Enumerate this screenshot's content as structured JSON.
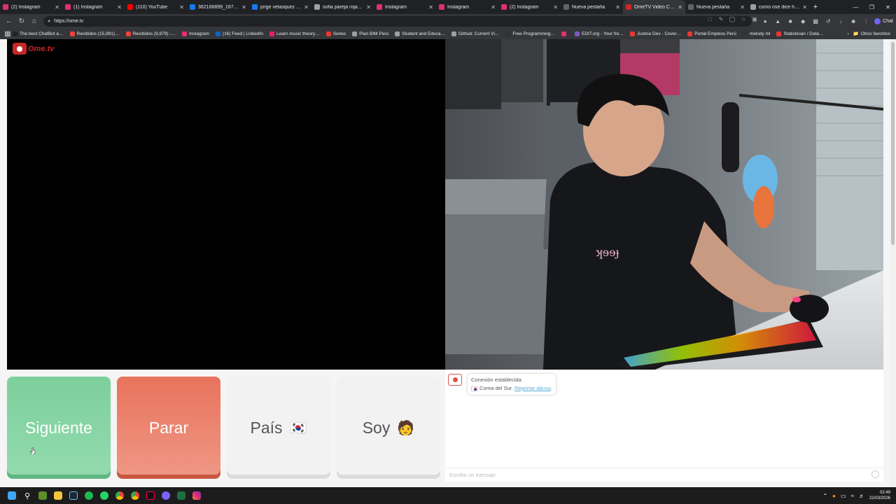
{
  "browser": {
    "tabs": [
      {
        "title": "(2) Instagram",
        "color": "#e1306c"
      },
      {
        "title": "(1) Instagram",
        "color": "#e1306c"
      },
      {
        "title": "(110) YouTube",
        "color": "#ff0000"
      },
      {
        "title": "362166899_16787548…",
        "color": "#1877f2"
      },
      {
        "title": "jorge velasquez mata…",
        "color": "#1877f2"
      },
      {
        "title": "sofia pareja rojas san…",
        "color": "#9aa0a6"
      },
      {
        "title": "Instagram",
        "color": "#e1306c"
      },
      {
        "title": "Instagram",
        "color": "#e1306c"
      },
      {
        "title": "(2) Instagram",
        "color": "#e1306c"
      },
      {
        "title": "Nueva pestaña",
        "color": "#5f6368"
      },
      {
        "title": "OmeTV Video Chat",
        "color": "#c62828",
        "active": true
      },
      {
        "title": "Nueva pestaña",
        "color": "#5f6368"
      },
      {
        "title": "como ose dice hola en…",
        "color": "#9aa0a6"
      }
    ],
    "url": "https://ome.tv",
    "chat_button": "Chat",
    "bookmarks": [
      {
        "label": "The best ChatBot a…",
        "color": "#222"
      },
      {
        "label": "Recibidos (15,891)…",
        "color": "#ea4335"
      },
      {
        "label": "Recibidos (9,879) -…",
        "color": "#ea4335"
      },
      {
        "label": "Instagram",
        "color": "#e1306c"
      },
      {
        "label": "(16) Feed | LinkedIn",
        "color": "#0a66c2"
      },
      {
        "label": "Learn music theory…",
        "color": "#e91e63"
      },
      {
        "label": "Series",
        "color": "#e53935"
      },
      {
        "label": "Plan BIM Perú",
        "color": "#9e9e9e"
      },
      {
        "label": "Student and Educa…",
        "color": "#9e9e9e"
      },
      {
        "label": "Github: Current Vi…",
        "color": "#9e9e9e"
      },
      {
        "label": "Free Programming…",
        "color": "#333"
      },
      {
        "label": "",
        "color": "#e1306c"
      },
      {
        "label": "EDIT.org - Your fre…",
        "color": "#7e57c2"
      },
      {
        "label": "Justice Dev - Cover…",
        "color": "#e53935"
      },
      {
        "label": "Portal Empleos Perú",
        "color": "#e53935"
      },
      {
        "label": "melody ml",
        "color": "#333"
      },
      {
        "label": "Statistician / Data…",
        "color": "#e53935"
      }
    ],
    "other_bookmarks": "Otros favoritos"
  },
  "app": {
    "logo_text": "Ome.tv",
    "buttons": {
      "next": "Siguiente",
      "stop": "Parar",
      "country": "País",
      "country_flag": "🇰🇷",
      "gender": "Soy",
      "gender_emoji": "🧑"
    },
    "chat": {
      "connected": "Conexión establecida.",
      "country": "Corea del Sur.",
      "report": "Reportar abuso",
      "report_suffix": ".",
      "placeholder": "Escribe un mensaje"
    }
  },
  "taskbar": {
    "time": "02:49",
    "date": "21/03/2026"
  }
}
